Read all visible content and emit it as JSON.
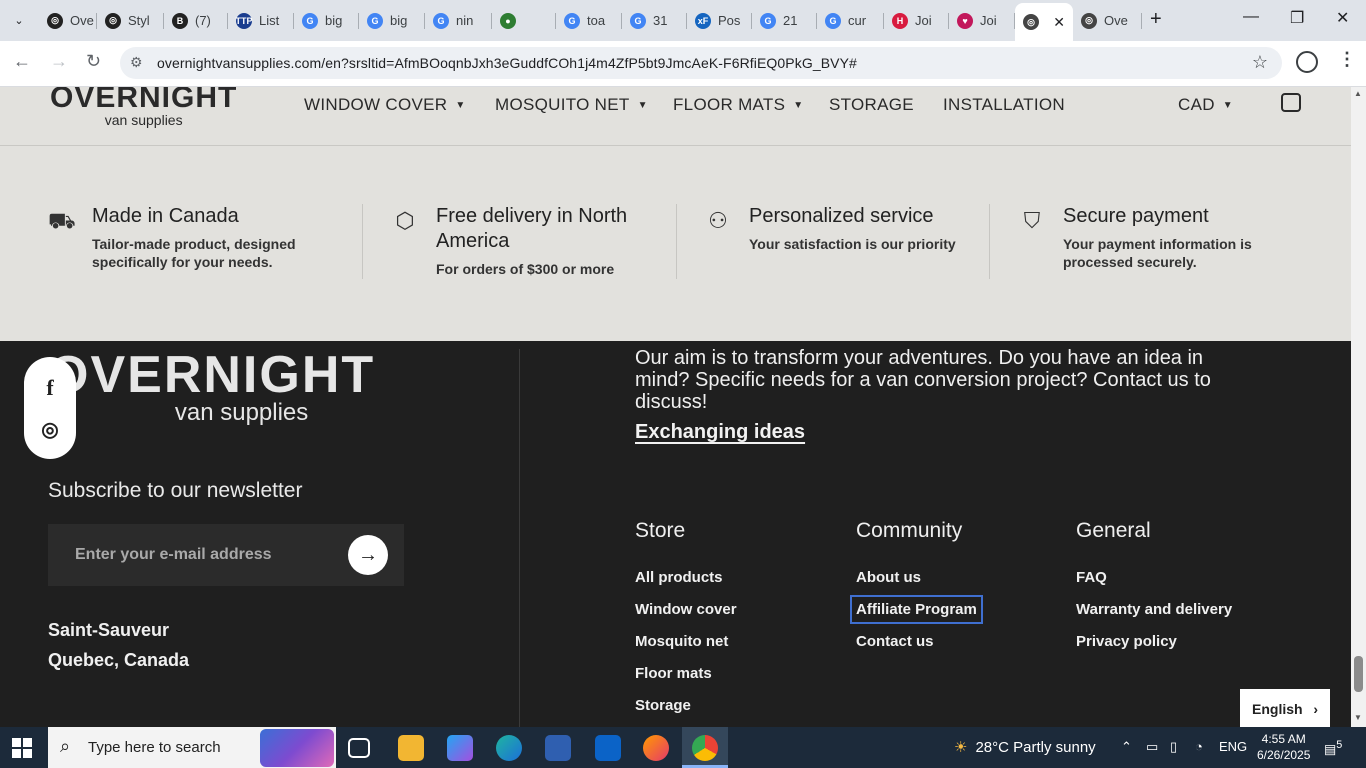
{
  "browser": {
    "tabs": [
      {
        "label": "Ove",
        "fav_color": "#222222",
        "fav_glyph": "◎"
      },
      {
        "label": "Styl",
        "fav_color": "#222222",
        "fav_glyph": "◎"
      },
      {
        "label": "(7)",
        "fav_color": "#222222",
        "fav_glyph": "B"
      },
      {
        "label": "List",
        "fav_color": "#1a3d8f",
        "fav_glyph": "TTP"
      },
      {
        "label": "big",
        "fav_color": "#4285f4",
        "fav_glyph": "G"
      },
      {
        "label": "big",
        "fav_color": "#4285f4",
        "fav_glyph": "G"
      },
      {
        "label": "nin",
        "fav_color": "#4285f4",
        "fav_glyph": "G"
      },
      {
        "label": "",
        "fav_color": "#2e7d32",
        "fav_glyph": "●"
      },
      {
        "label": "toa",
        "fav_color": "#4285f4",
        "fav_glyph": "G"
      },
      {
        "label": "31",
        "fav_color": "#4285f4",
        "fav_glyph": "G"
      },
      {
        "label": "Pos",
        "fav_color": "#1565c0",
        "fav_glyph": "xF"
      },
      {
        "label": "21",
        "fav_color": "#4285f4",
        "fav_glyph": "G"
      },
      {
        "label": "cur",
        "fav_color": "#4285f4",
        "fav_glyph": "G"
      },
      {
        "label": "Joi",
        "fav_color": "#d81b3f",
        "fav_glyph": "H"
      },
      {
        "label": "Joi",
        "fav_color": "#c2185b",
        "fav_glyph": "♥"
      },
      {
        "label": "",
        "fav_color": "#444444",
        "fav_glyph": "◎",
        "active": true
      },
      {
        "label": "Ove",
        "fav_color": "#444444",
        "fav_glyph": "◎"
      }
    ],
    "url": "overnightvansupplies.com/en?srsltid=AfmBOoqnbJxh3eGuddfCOh1j4m4ZfP5bt9JmcAeK-F6RfiEQ0PkG_BVY#"
  },
  "site": {
    "logo_big": "OVERNIGHT",
    "logo_small": "van supplies",
    "nav": [
      "WINDOW COVER",
      "MOSQUITO NET",
      "FLOOR MATS",
      "STORAGE",
      "INSTALLATION"
    ],
    "currency": "CAD",
    "features": [
      {
        "title": "Made in Canada",
        "text": "Tailor-made product, designed specifically for your needs.",
        "icon": "van-icon"
      },
      {
        "title": "Free delivery in North America",
        "text": "For orders of $300 or more",
        "icon": "box-icon"
      },
      {
        "title": "Personalized service",
        "text": "Your satisfaction is our priority",
        "icon": "users-icon"
      },
      {
        "title": "Secure payment",
        "text": "Your payment information is processed securely.",
        "icon": "shield-check-icon"
      }
    ],
    "footer": {
      "newsletter_title": "Subscribe to our newsletter",
      "email_placeholder": "Enter your e-mail address",
      "address_line1": "Saint-Sauveur",
      "address_line2": "Quebec, Canada",
      "aim": "Our aim is to transform your adventures. Do you have an idea in mind? Specific needs for a van conversion project? Contact us to discuss!",
      "exchange_link": "Exchanging ideas",
      "columns": [
        {
          "title": "Store",
          "links": [
            "All products",
            "Window cover",
            "Mosquito net",
            "Floor mats",
            "Storage"
          ]
        },
        {
          "title": "Community",
          "links": [
            "About us",
            "Affiliate Program",
            "Contact us"
          ]
        },
        {
          "title": "General",
          "links": [
            "FAQ",
            "Warranty and delivery",
            "Privacy policy"
          ]
        }
      ],
      "language": "English"
    }
  },
  "taskbar": {
    "search_placeholder": "Type here to search",
    "weather": "28°C  Partly sunny",
    "lang": "ENG",
    "time": "4:55 AM",
    "date": "6/26/2025",
    "notification_count": "5"
  }
}
